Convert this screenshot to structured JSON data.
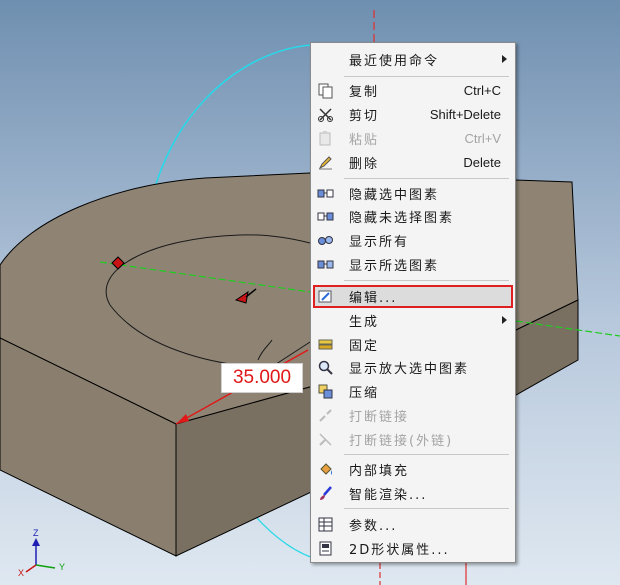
{
  "dimension": {
    "value": "35.000"
  },
  "axis_triad": {
    "z": "Z",
    "x": "X",
    "y": "Y"
  },
  "context_menu": {
    "recent": {
      "label": "最近使用命令"
    },
    "copy": {
      "label": "复制",
      "shortcut": "Ctrl+C"
    },
    "cut": {
      "label": "剪切",
      "shortcut": "Shift+Delete"
    },
    "paste": {
      "label": "粘贴",
      "shortcut": "Ctrl+V"
    },
    "delete": {
      "label": "删除",
      "shortcut": "Delete"
    },
    "hide_selected": {
      "label": "隐藏选中图素"
    },
    "hide_unselected": {
      "label": "隐藏未选择图素"
    },
    "show_all": {
      "label": "显示所有"
    },
    "show_selected": {
      "label": "显示所选图素"
    },
    "edit": {
      "label": "编辑..."
    },
    "generate": {
      "label": "生成"
    },
    "fix": {
      "label": "固定"
    },
    "zoom_selected": {
      "label": "显示放大选中图素"
    },
    "compress": {
      "label": "压缩"
    },
    "break_link": {
      "label": "打断链接"
    },
    "break_link_external": {
      "label": "打断链接(外链)"
    },
    "interior_fill": {
      "label": "内部填充"
    },
    "smart_render": {
      "label": "智能渲染..."
    },
    "parameters": {
      "label": "参数..."
    },
    "shape_2d_props": {
      "label": "2D形状属性..."
    }
  }
}
